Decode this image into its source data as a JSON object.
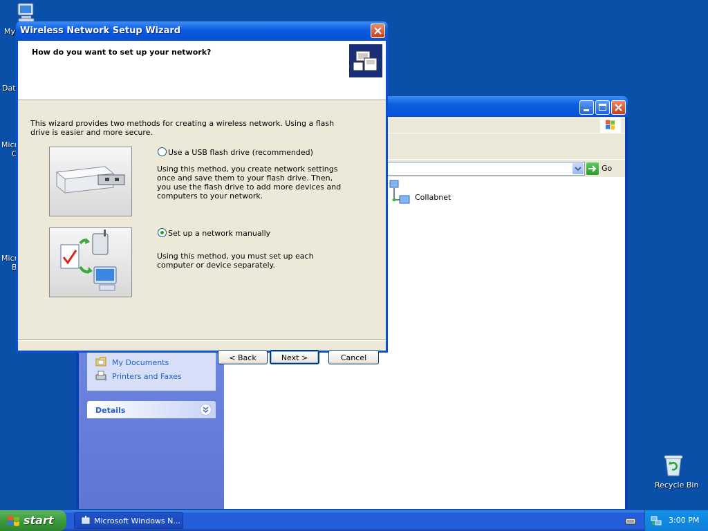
{
  "desktop": {
    "left_labels": [
      "My",
      "Dat",
      "Micr",
      "C",
      "Micr",
      "B"
    ],
    "recycle_bin_label": "Recycle Bin"
  },
  "explorer": {
    "go_label": "Go",
    "network_item": "Collabnet",
    "other_places": [
      "My Documents",
      "Printers and Faxes"
    ],
    "details_label": "Details"
  },
  "wizard": {
    "title": "Wireless Network Setup Wizard",
    "question": "How do you want to set up your network?",
    "intro": "This wizard provides two methods for creating a wireless network. Using a flash drive is easier and more secure.",
    "option_usb_label": "Use a USB flash drive (recommended)",
    "option_usb_desc": "Using this method, you create network settings once and save them to your flash drive. Then, you use the flash drive to add more devices and computers to your network.",
    "option_usb_checked": false,
    "option_manual_label": "Set up a network manually",
    "option_manual_desc": "Using this method, you must set up each computer or device separately.",
    "option_manual_checked": true,
    "back_label": "< Back",
    "next_label": "Next >",
    "cancel_label": "Cancel"
  },
  "taskbar": {
    "start_label": "start",
    "task_label": "Microsoft Windows N...",
    "clock": "3:00 PM"
  }
}
